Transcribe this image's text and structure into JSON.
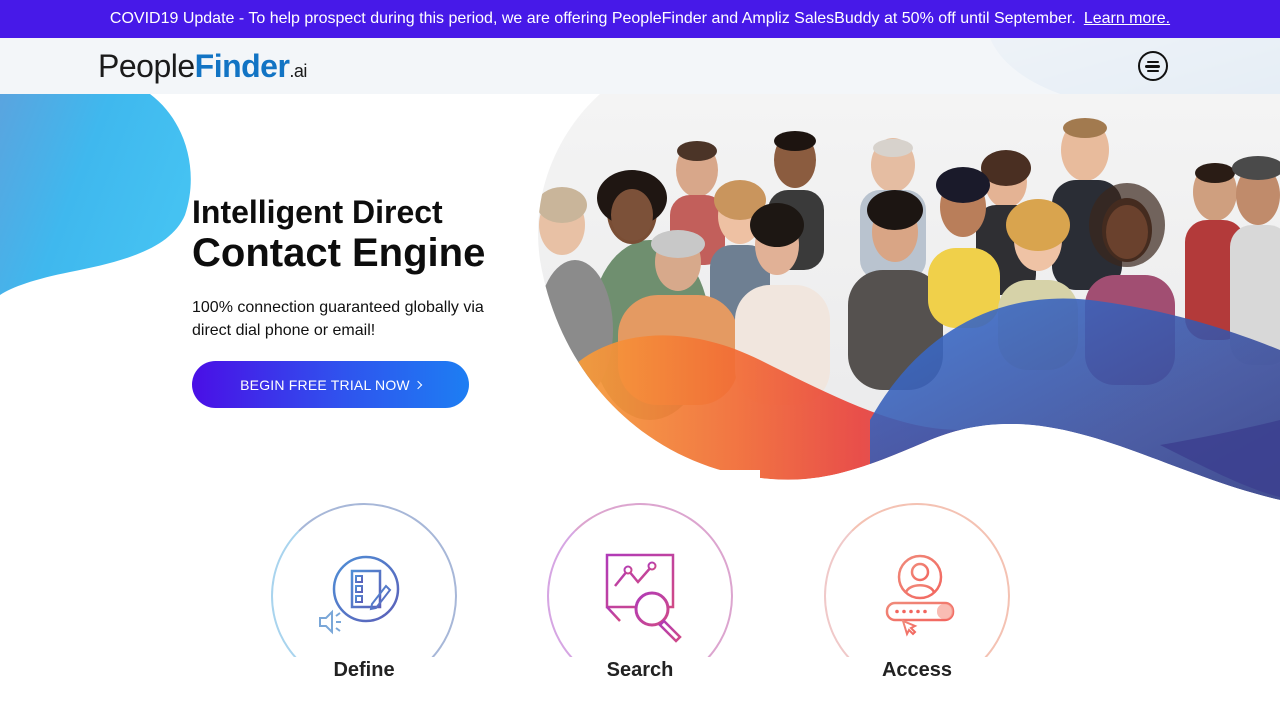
{
  "promo": {
    "text": "COVID19 Update - To help prospect during this period, we are offering PeopleFinder and Ampliz SalesBuddy at 50% off until September.",
    "link_label": "Learn more."
  },
  "header": {
    "logo": {
      "part1": "People",
      "part2": "Finder",
      "part3": ".ai"
    },
    "menu_icon": "hamburger-menu-icon"
  },
  "hero": {
    "title_line1": "Intelligent Direct",
    "title_line2": "Contact Engine",
    "subtitle": "100% connection guaranteed globally via direct dial phone or email!",
    "cta_label": "BEGIN FREE TRIAL NOW"
  },
  "features": [
    {
      "label": "Define",
      "icon": "checklist-icon"
    },
    {
      "label": "Search",
      "icon": "chart-search-icon"
    },
    {
      "label": "Access",
      "icon": "user-access-icon"
    }
  ],
  "colors": {
    "promo_bg": "#4719e8",
    "brand_blue": "#1274c4",
    "cta_start": "#4a0fe6",
    "cta_end": "#1d7ef3"
  }
}
